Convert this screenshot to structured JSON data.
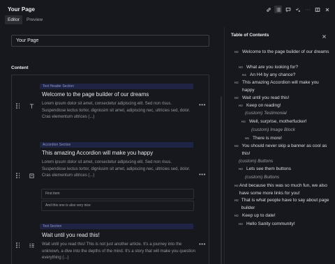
{
  "header": {
    "title": "Your Page",
    "tabs": [
      {
        "label": "Editor",
        "active": true
      },
      {
        "label": "Preview",
        "active": false
      }
    ],
    "toolbar_icons": [
      "link-icon",
      "list-icon",
      "comment-icon",
      "tasks-icon",
      "more-icon",
      "split-pane-icon",
      "close-icon"
    ]
  },
  "editor": {
    "title_value": "Your Page",
    "content_label": "Content",
    "blocks": [
      {
        "badge": "Text Header Section",
        "title": "Welcome to the page builder of our dreams",
        "text": "Lorem ipsum dolor sit amet, consectetur adipiscing elit. Sed non risus. Suspendisse lectus tortor, dignissim sit amet, adipiscing nec, ultricies sed, dolor. Cras elementum ultrices (...)",
        "icon": "text-icon"
      },
      {
        "badge": "Accordion Section",
        "title": "This amazing Accordion will make you happy",
        "text": "Lorem ipsum dolor sit amet, consectetur adipiscing elit. Sed non risus. Suspendisse lectus tortor, dignissim sit amet, adipiscing nec, ultricies sed, dolor. Cras elementum ultrices (...)",
        "icon": "accordion-icon",
        "items": [
          "First item",
          "And this one is also very nice"
        ]
      },
      {
        "badge": "Text Section",
        "title": "Wait until you read this!",
        "text": "Wait until you read this! This is not just another article. It's a journey into the unknown, a dive into the depths of the mind. It's a story that will make you question everything (...)",
        "icon": "paragraph-icon"
      }
    ]
  },
  "toc": {
    "title": "Table of Contents",
    "entries": [
      {
        "level": "H2",
        "text": "Welcome to the page builder of our dreams"
      },
      {
        "level": "H3",
        "text": "What are you looking for?"
      },
      {
        "level": "H4",
        "text": "An H4 by any chance?"
      },
      {
        "level": "H2",
        "text": "This amazing Accordion will make you happy"
      },
      {
        "level": "H2",
        "text": "Wait until you read this!"
      },
      {
        "level": "H3",
        "text": "Keep on reading!"
      },
      {
        "level": "",
        "text": "(custom) Testimonial"
      },
      {
        "level": "H3",
        "text": "Well, surprise, motherfucker!"
      },
      {
        "level": "",
        "text": "(custom) Image Block"
      },
      {
        "level": "H5",
        "text": "There is more!"
      },
      {
        "level": "H2",
        "text": "You should never skip a banner as cool as this!"
      },
      {
        "level": "",
        "text": "(custom) Buttons"
      },
      {
        "level": "H3",
        "text": "Lets see them buttons"
      },
      {
        "level": "",
        "text": "(custom) Buttons"
      },
      {
        "level": "H2",
        "text": "And because this was so much fun, we also have some more links for you!"
      },
      {
        "level": "H2",
        "text": "That is what people have to say about page builder"
      },
      {
        "level": "H2",
        "text": "Keep up to date!"
      },
      {
        "level": "H3",
        "text": "Hello Sanity community!"
      }
    ]
  }
}
